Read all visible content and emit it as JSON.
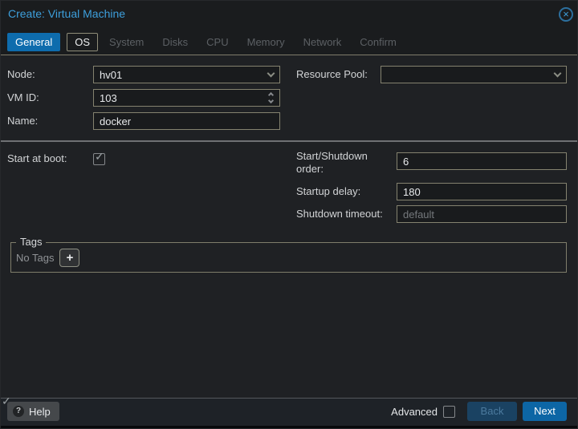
{
  "window": {
    "title": "Create: Virtual Machine"
  },
  "icons": {
    "close": "×",
    "help": "?",
    "check": "✓"
  },
  "tabs": [
    {
      "label": "General",
      "state": "active"
    },
    {
      "label": "OS",
      "state": "focused"
    },
    {
      "label": "System",
      "state": "disabled"
    },
    {
      "label": "Disks",
      "state": "disabled"
    },
    {
      "label": "CPU",
      "state": "disabled"
    },
    {
      "label": "Memory",
      "state": "disabled"
    },
    {
      "label": "Network",
      "state": "disabled"
    },
    {
      "label": "Confirm",
      "state": "disabled"
    }
  ],
  "form": {
    "node": {
      "label": "Node:",
      "value": "hv01"
    },
    "vm_id": {
      "label": "VM ID:",
      "value": "103"
    },
    "name": {
      "label": "Name:",
      "value": "docker"
    },
    "resource_pool": {
      "label": "Resource Pool:",
      "value": ""
    },
    "start_at_boot": {
      "label": "Start at boot:",
      "checked": true
    },
    "start_shutdown_order": {
      "label": "Start/Shutdown order:",
      "value": "6"
    },
    "startup_delay": {
      "label": "Startup delay:",
      "value": "180"
    },
    "shutdown_timeout": {
      "label": "Shutdown timeout:",
      "placeholder": "default"
    },
    "tags": {
      "legend": "Tags",
      "empty_text": "No Tags",
      "add_label": "+"
    }
  },
  "footer": {
    "help": "Help",
    "advanced": "Advanced",
    "advanced_checked": true,
    "back": "Back",
    "next": "Next"
  },
  "colors": {
    "title_blue": "#3d9fdc",
    "active_tab_blue": "#0e6cad",
    "next_button_blue": "#0d66a5",
    "panel_border_tan": "#7f7d6b",
    "panel_bg": "#1f2124"
  }
}
